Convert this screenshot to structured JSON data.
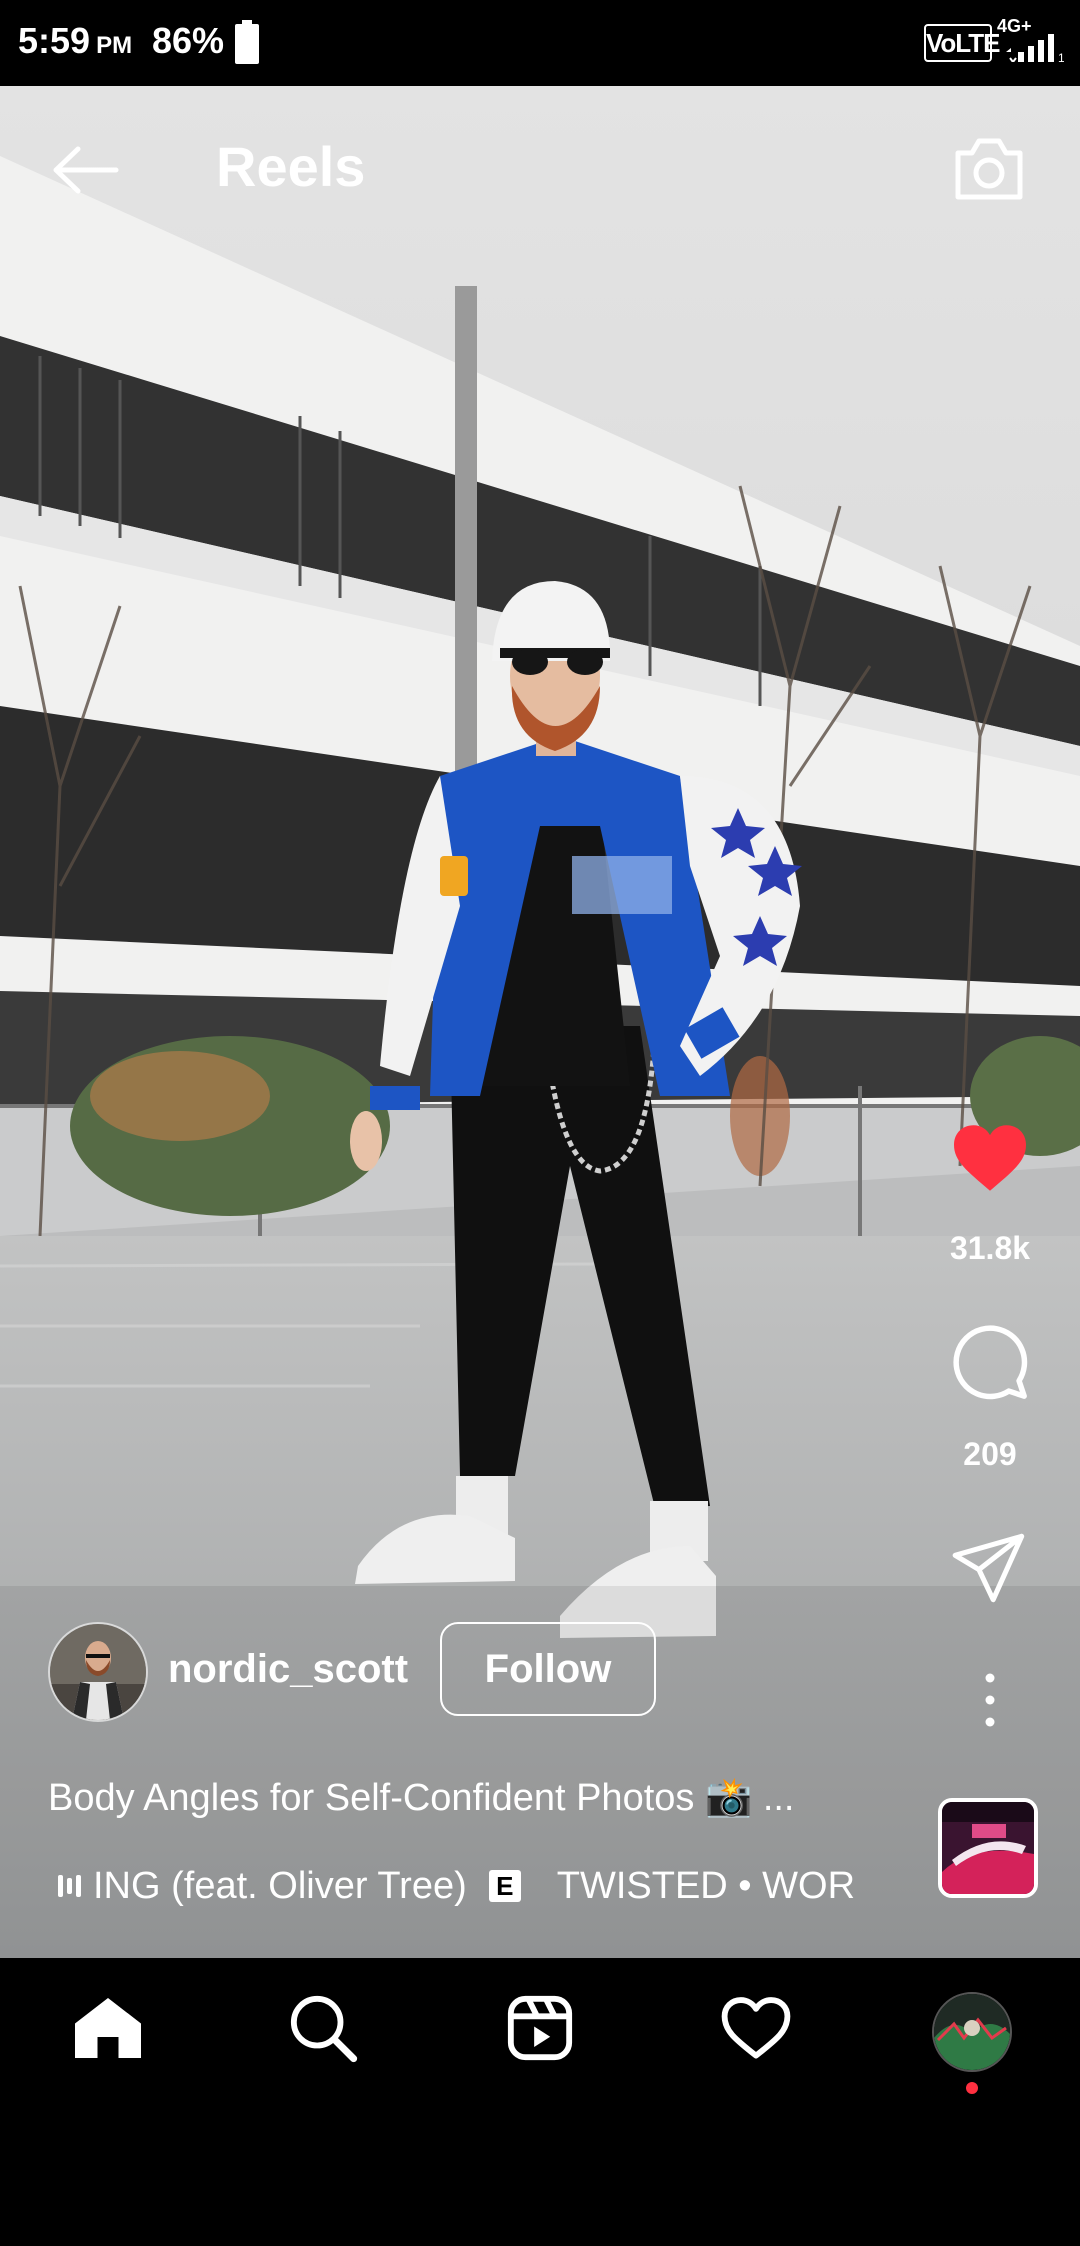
{
  "status_bar": {
    "time": "5:59",
    "ampm": "PM",
    "battery": "86%",
    "volte": "VoLTE",
    "network": "4G+",
    "sim": "1"
  },
  "header": {
    "title": "Reels"
  },
  "actions": {
    "likes": "31.8k",
    "comments": "209"
  },
  "post": {
    "username": "nordic_scott",
    "follow_label": "Follow",
    "caption": "Body Angles for Self-Confident Photos 📸 ...",
    "track": "ING (feat. Oliver Tree)",
    "explicit_badge": "E",
    "audio_next": "TWISTED • WOR"
  },
  "nav": [
    "home-icon",
    "search-icon",
    "reels-icon",
    "heart-icon",
    "profile-avatar"
  ],
  "colors": {
    "like": "#ff3040",
    "sky": "#d8d8d8",
    "ground": "#b2b4b4",
    "jacket": "#1d55c4"
  }
}
